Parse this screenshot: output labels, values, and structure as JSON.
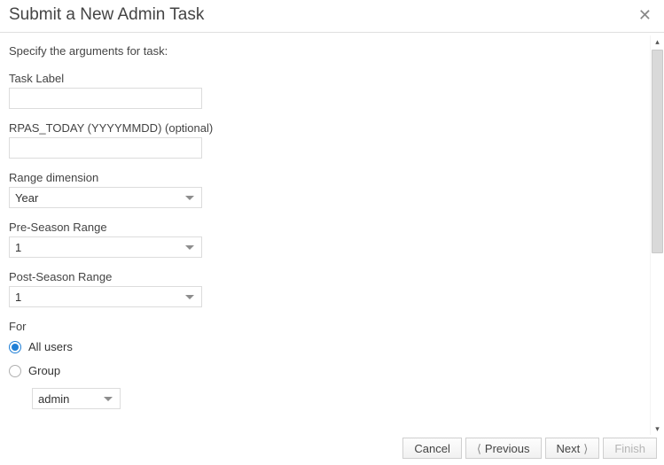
{
  "header": {
    "title": "Submit a New Admin Task"
  },
  "body": {
    "instructions": "Specify the arguments for task:",
    "taskLabel": {
      "label": "Task Label",
      "value": ""
    },
    "rpasToday": {
      "label": "RPAS_TODAY (YYYYMMDD) (optional)",
      "value": ""
    },
    "rangeDimension": {
      "label": "Range dimension",
      "value": "Year"
    },
    "preSeason": {
      "label": "Pre-Season Range",
      "value": "1"
    },
    "postSeason": {
      "label": "Post-Season Range",
      "value": "1"
    },
    "forSection": {
      "label": "For",
      "options": {
        "allUsers": "All users",
        "group": "Group"
      },
      "selected": "allUsers",
      "groupSelect": "admin"
    }
  },
  "footer": {
    "cancel": "Cancel",
    "previous": "Previous",
    "next": "Next",
    "finish": "Finish"
  }
}
